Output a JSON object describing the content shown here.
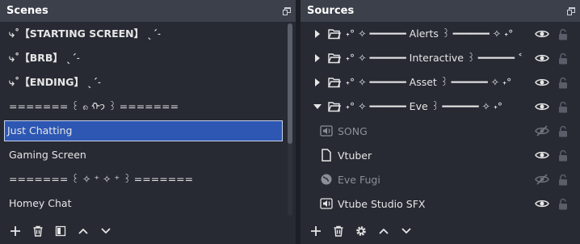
{
  "scenes": {
    "title": "Scenes",
    "items": [
      "⤷˚【STARTING SCREEN】 ˎˊ˗",
      "⤷˚【BRB】 ˎˊ˗",
      "⤷˚【ENDING】 ˎˊ˗",
      "======= ꒰ ၈ ᡣ𐭩 ꒱ =======",
      "Just Chatting",
      "Gaming Screen",
      "======= ꒰ ✧ ⁺ ✧ ⁺ ꒱ =======",
      "Homey Chat"
    ],
    "selected_index": 4
  },
  "sources": {
    "title": "Sources",
    "items": [
      {
        "name": "˖° ✧ ━━━━━━ Alerts ꒱ ━━━━━━ ✧ ˖°",
        "kind": "group",
        "expanded": false,
        "visible": true
      },
      {
        "name": "˖° ✧ ━━━━━━ Interactive ꒱ ━━━━━━ ˂",
        "kind": "group",
        "expanded": false,
        "visible": true
      },
      {
        "name": "˖° ✧ ━━━━━━ Asset ꒱ ━━━━━━ ✧ ˖°",
        "kind": "group",
        "expanded": false,
        "visible": true
      },
      {
        "name": "˖° ✧ ━━━━━━ Eve ꒱ ━━━━━━ ✧ ˖°",
        "kind": "group",
        "expanded": true,
        "visible": true
      },
      {
        "name": "SONG",
        "kind": "audio",
        "visible": false
      },
      {
        "name": "Vtuber",
        "kind": "file",
        "visible": true
      },
      {
        "name": "Eve Fugi",
        "kind": "browser",
        "visible": false
      },
      {
        "name": "Vtube Studio SFX",
        "kind": "audio",
        "visible": true
      }
    ]
  },
  "colors": {
    "background": "#1d1f26",
    "panel": "#272a33",
    "header": "#3c404b",
    "selection": "#2d57b3",
    "text": "#e6e6e6",
    "dim_text": "#8c8f96"
  }
}
